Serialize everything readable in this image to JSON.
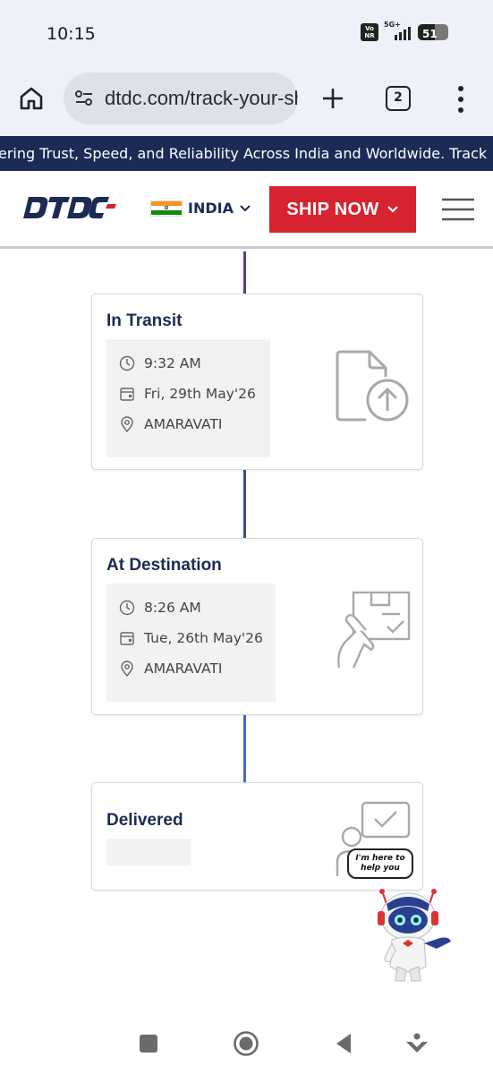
{
  "status_bar": {
    "time": "10:15",
    "network": "5G+",
    "volte": "VoNR",
    "battery": "51"
  },
  "browser": {
    "url": "dtdc.com/track-your-shipment",
    "tab_count": "2"
  },
  "ticker": {
    "text": "ering Trust, Speed, and Reliability Across India and Worldwide. Track"
  },
  "header": {
    "country": "INDIA",
    "ship_now": "SHIP NOW"
  },
  "tracking": {
    "events": [
      {
        "status": "In Transit",
        "time": "9:32 AM",
        "date": "Fri, 29th May'26",
        "location": "AMARAVATI",
        "icon": "document-upload-icon"
      },
      {
        "status": "At Destination",
        "time": "8:26 AM",
        "date": "Tue, 26th May'26",
        "location": "AMARAVATI",
        "icon": "hand-package-icon"
      },
      {
        "status": "Delivered",
        "icon": "person-check-icon"
      }
    ]
  },
  "bot": {
    "bubble": "I'm here to help you"
  },
  "colors": {
    "brand_navy": "#1b2b55",
    "brand_red": "#d7232f",
    "timeline_purple": "#5a3e8a",
    "timeline_indigo": "#3d4aa0",
    "timeline_blue": "#3a6fc9"
  }
}
